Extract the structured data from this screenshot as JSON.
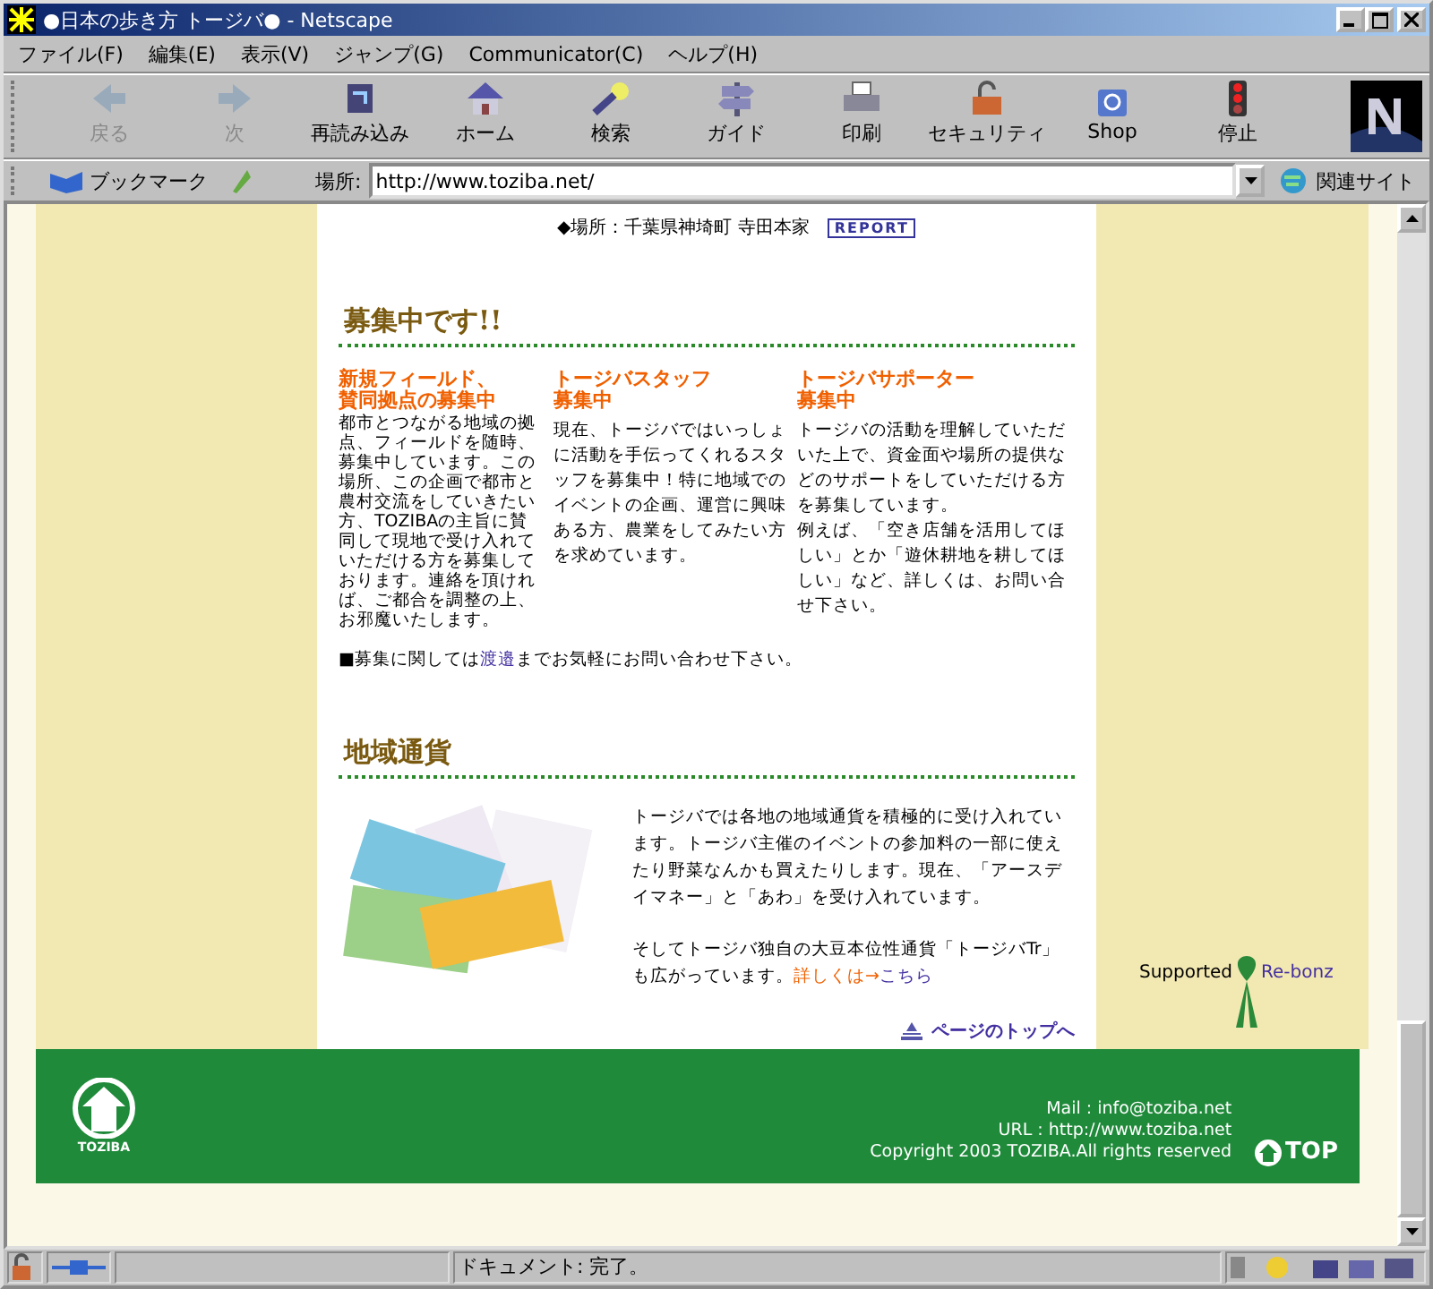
{
  "window": {
    "title": "●日本の歩き方 トージバ● - Netscape"
  },
  "menu": [
    "ファイル(F)",
    "編集(E)",
    "表示(V)",
    "ジャンプ(G)",
    "Communicator(C)",
    "ヘルプ(H)"
  ],
  "toolbar": [
    {
      "label": "戻る",
      "kind": "back",
      "disabled": true
    },
    {
      "label": "次",
      "kind": "forward",
      "disabled": true
    },
    {
      "label": "再読み込み",
      "kind": "reload",
      "disabled": false
    },
    {
      "label": "ホーム",
      "kind": "home",
      "disabled": false
    },
    {
      "label": "検索",
      "kind": "search",
      "disabled": false
    },
    {
      "label": "ガイド",
      "kind": "guide",
      "disabled": false
    },
    {
      "label": "印刷",
      "kind": "print",
      "disabled": false
    },
    {
      "label": "セキュリティ",
      "kind": "security",
      "disabled": false
    },
    {
      "label": "Shop",
      "kind": "shop",
      "disabled": false
    },
    {
      "label": "停止",
      "kind": "stop",
      "disabled": false
    }
  ],
  "location_bar": {
    "bookmarks": "ブックマーク",
    "label": "場所:",
    "url": "http://www.toziba.net/",
    "related": "関連サイト"
  },
  "page": {
    "event_place": "◆場所：千葉県神埼町 寺田本家",
    "report_badge": "REPORT",
    "recruit": {
      "heading": "募集中です!!",
      "columns": [
        {
          "title_lines": [
            "新規フィールド、",
            "賛同拠点の募集中"
          ],
          "paragraphs": [
            "都市とつながる地域の拠点、フィールドを随時、募集中しています。この場所、この企画で都市と農村交流をしていきたい方、TOZIBAの主旨に賛同して現地で受け入れていただける方を募集しております。連絡を頂ければ、ご都合を調整の上、お邪魔いたします。"
          ]
        },
        {
          "title_lines": [
            "トージバスタッフ",
            "募集中"
          ],
          "paragraphs": [
            "現在、トージバではいっしょに活動を手伝ってくれるスタッフを募集中！特に地域でのイベントの企画、運営に興味ある方、農業をしてみたい方を求めています。"
          ]
        },
        {
          "title_lines": [
            "トージバサポーター",
            "募集中"
          ],
          "paragraphs": [
            "トージバの活動を理解していただいた上で、資金面や場所の提供などのサポートをしていただける方を募集しています。",
            "例えば、「空き店舗を活用してほしい」とか「遊休耕地を耕してほしい」など、詳しくは、お問い合せ下さい。"
          ]
        }
      ],
      "note_before": "■募集に関しては",
      "note_link": "渡邉",
      "note_after": "までお気軽にお問い合わせ下さい。"
    },
    "currency": {
      "heading": "地域通貨",
      "paragraph_1": "トージバでは各地の地域通貨を積極的に受け入れています。トージバ主催のイベントの参加料の一部に使えたり野菜なんかも買えたりします。現在、「アースデイマネー」と「あわ」を受け入れています。",
      "paragraph_2": "そしてトージバ独自の大豆本位性通貨「トージバTr」も広がっています。",
      "more_label": "詳しくは→",
      "more_link": "こちら"
    },
    "page_top": "ページのトップへ",
    "supported_label": "Supported",
    "supported_link": "Re-bonz",
    "footer": {
      "logo_text": "TOZIBA",
      "mail": "Mail : info@toziba.net",
      "url": "URL : http://www.toziba.net",
      "copyright": "Copyright 2003 TOZIBA.All rights reserved",
      "top_button": "TOP"
    }
  },
  "status_bar": {
    "text": "ドキュメント: 完了。"
  }
}
